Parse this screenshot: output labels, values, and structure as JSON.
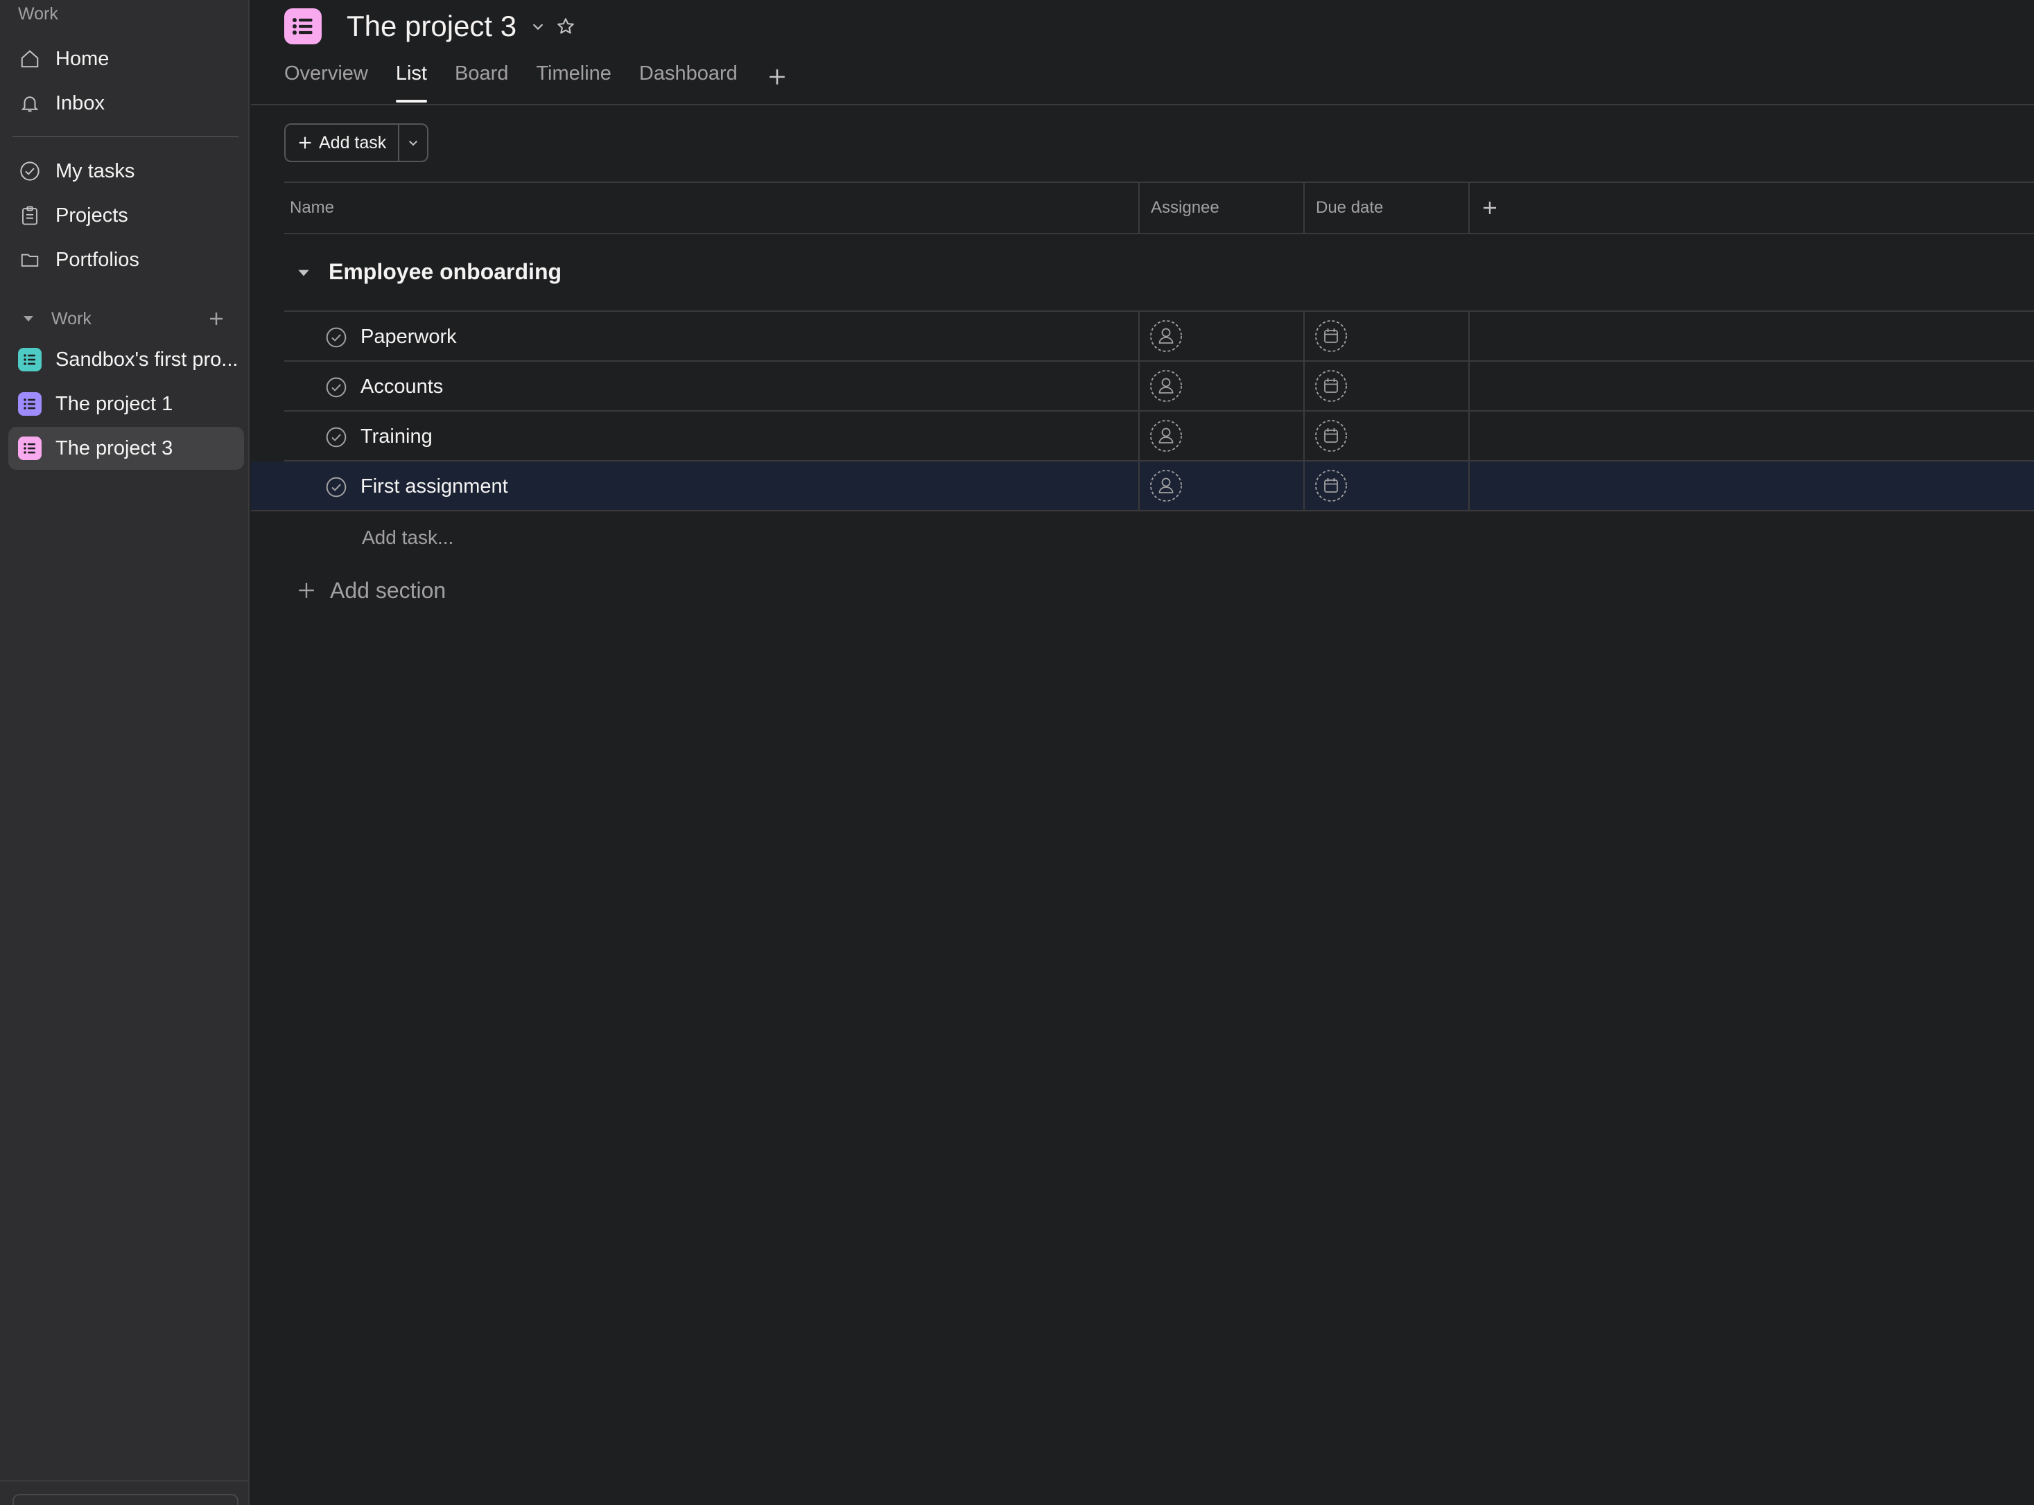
{
  "sidebar": {
    "top_label": "Work",
    "nav": [
      {
        "label": "Home",
        "icon": "home-icon"
      },
      {
        "label": "Inbox",
        "icon": "bell-icon"
      }
    ],
    "nav2": [
      {
        "label": "My tasks",
        "icon": "check-circle-icon"
      },
      {
        "label": "Projects",
        "icon": "clipboard-icon"
      },
      {
        "label": "Portfolios",
        "icon": "folder-icon"
      }
    ],
    "section_label": "Work",
    "projects": [
      {
        "label": "Sandbox's first pro...",
        "color": "#4ecbc4"
      },
      {
        "label": "The project 1",
        "color": "#9e8cfc"
      },
      {
        "label": "The project 3",
        "color": "#f9aaef",
        "active": true
      }
    ]
  },
  "header": {
    "title": "The project 3",
    "project_color": "#f9aaef",
    "tabs": [
      "Overview",
      "List",
      "Board",
      "Timeline",
      "Dashboard"
    ],
    "active_tab": "List"
  },
  "toolbar": {
    "add_task_label": "Add task"
  },
  "table": {
    "columns": {
      "name": "Name",
      "assignee": "Assignee",
      "due_date": "Due date"
    },
    "section_name": "Employee onboarding",
    "tasks": [
      {
        "name": "Paperwork"
      },
      {
        "name": "Accounts"
      },
      {
        "name": "Training"
      },
      {
        "name": "First assignment"
      }
    ],
    "add_task_placeholder": "Add task...",
    "add_section_label": "Add section"
  }
}
